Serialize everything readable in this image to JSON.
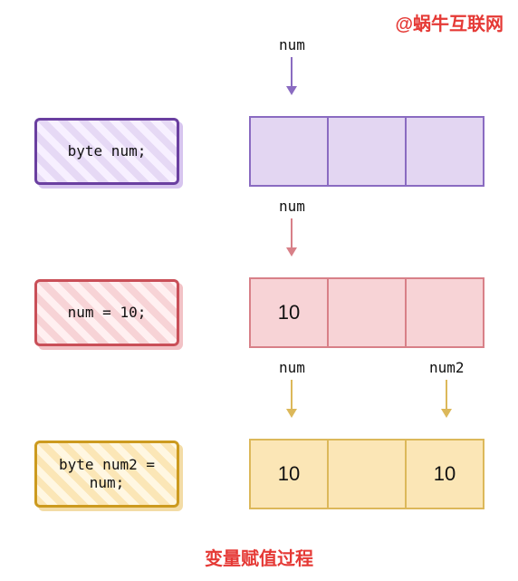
{
  "watermark": "@蜗牛互联网",
  "caption": "变量赋值过程",
  "steps": [
    {
      "code": "byte num;",
      "arrows": [
        {
          "label": "num",
          "color": "purple"
        }
      ],
      "cells": [
        "",
        "",
        ""
      ],
      "color": "purple"
    },
    {
      "code": "num = 10;",
      "arrows": [
        {
          "label": "num",
          "color": "red"
        }
      ],
      "cells": [
        "10",
        "",
        ""
      ],
      "color": "red"
    },
    {
      "code": "byte num2 =\n  num;",
      "arrows": [
        {
          "label": "num",
          "color": "gold"
        },
        {
          "label": "num2",
          "color": "gold"
        }
      ],
      "cells": [
        "10",
        "",
        "10"
      ],
      "color": "gold"
    }
  ]
}
